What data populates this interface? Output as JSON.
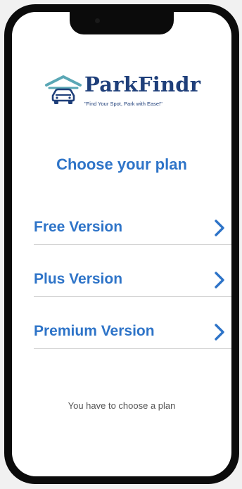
{
  "logo": {
    "name": "ParkFindr",
    "tagline": "\"Find Your Spot, Park with Ease!\"",
    "icon": "car-garage-icon"
  },
  "header": {
    "title": "Choose your plan"
  },
  "plans": [
    {
      "label": "Free Version",
      "icon": "chevron-right-icon"
    },
    {
      "label": "Plus Version",
      "icon": "chevron-right-icon"
    },
    {
      "label": "Premium Version",
      "icon": "chevron-right-icon"
    }
  ],
  "footer": {
    "hint": "You have to choose a plan"
  },
  "colors": {
    "accent": "#2e74c8",
    "brand": "#1f3f7a",
    "logo_icon": "#5aa7b5",
    "frame": "#0b0b0b"
  }
}
